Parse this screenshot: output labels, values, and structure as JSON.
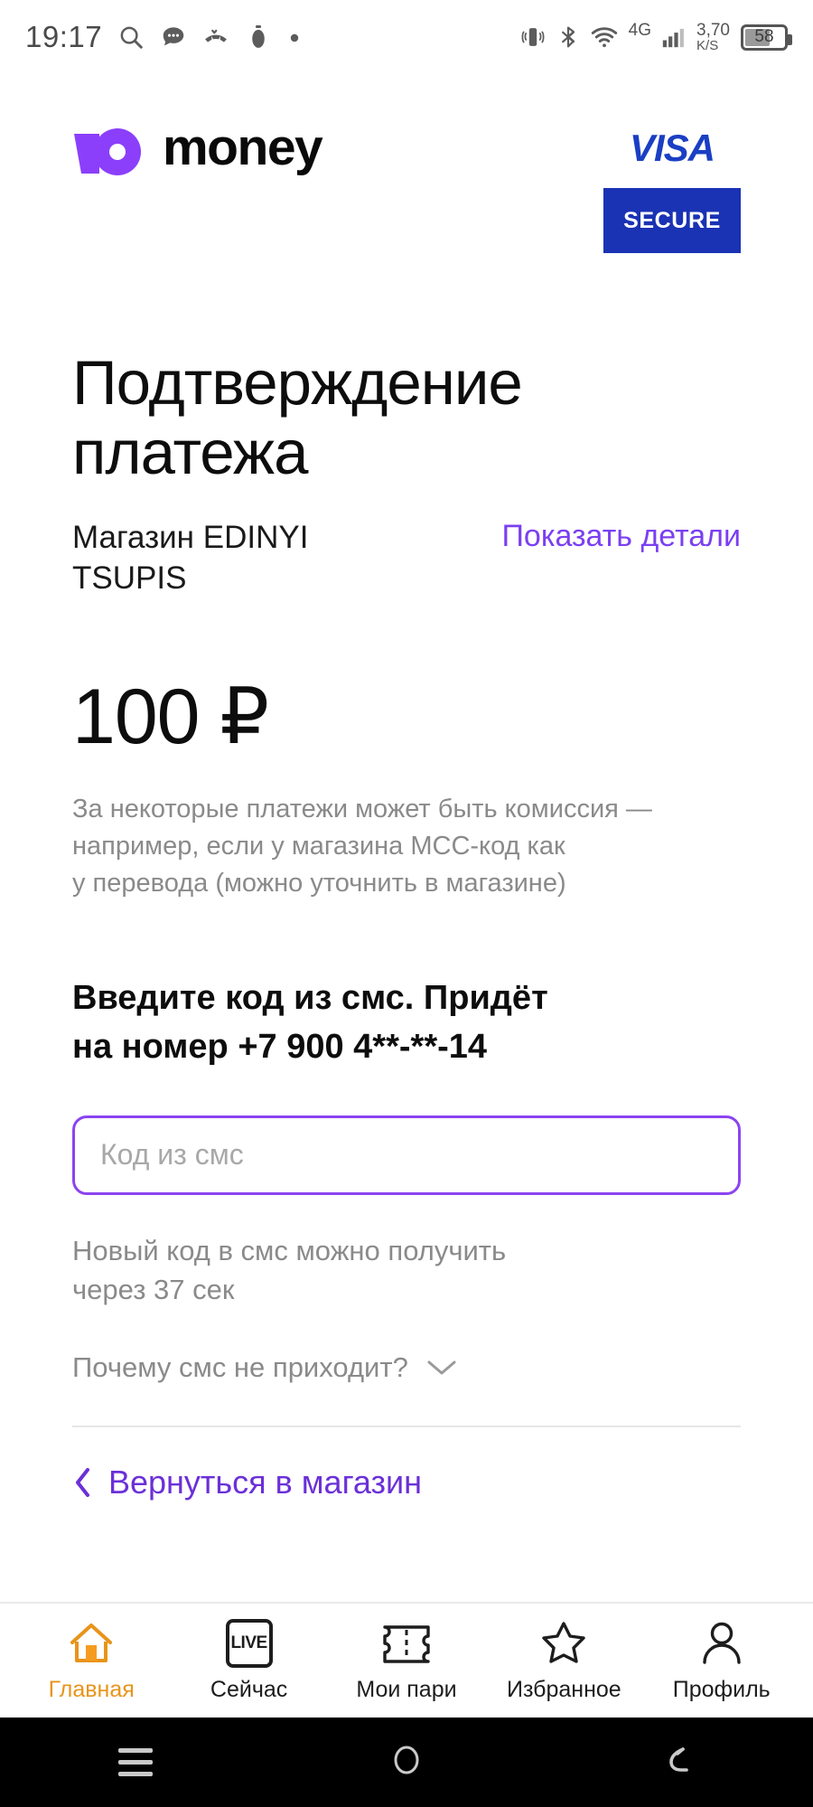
{
  "status_bar": {
    "time": "19:17",
    "left_icons": [
      "search-icon",
      "message-icon",
      "missed-call-icon",
      "timer-icon",
      "dot-icon"
    ],
    "right_icons": [
      "vibrate-icon",
      "bluetooth-icon",
      "wifi-icon",
      "signal-icon"
    ],
    "network_type": "4G",
    "data_rate_value": "3,70",
    "data_rate_unit": "K/S",
    "battery_level": "58"
  },
  "brand": {
    "logo_mark": "yoomoney-yu-icon",
    "logo_word": "money",
    "visa_word": "VISA",
    "visa_secure_label": "SECURE",
    "visa_blue": "#1a32b4"
  },
  "content": {
    "title": "Подтверждение платежа",
    "merchant_line1": "Магазин EDINYI",
    "merchant_line2": "TSUPIS",
    "show_details_link": "Показать детали",
    "amount": "100 ₽",
    "commission_note_line1": "За некоторые платежи может быть комиссия —",
    "commission_note_line2": "например, если у магазина MCC-код как",
    "commission_note_line3": "у перевода (можно уточнить в магазине)",
    "sms_heading_line1": "Введите код из смс. Придёт",
    "sms_heading_line2": "на номер +7 900 4**-**-14",
    "code_placeholder": "Код из смс",
    "code_value": "",
    "resend_line1": "Новый код в смс можно получить",
    "resend_line2": "через 37 сек",
    "resend_seconds": "37",
    "faq_question": "Почему смс не приходит?",
    "back_to_shop": "Вернуться в магазин",
    "accent_purple": "#7b3ff2"
  },
  "app_nav": {
    "items": [
      {
        "label": "Главная",
        "icon": "home-icon",
        "active": true
      },
      {
        "label": "Сейчас",
        "icon": "live-icon",
        "active": false
      },
      {
        "label": "Мои пари",
        "icon": "ticket-icon",
        "active": false
      },
      {
        "label": "Избранное",
        "icon": "star-icon",
        "active": false
      },
      {
        "label": "Профиль",
        "icon": "person-icon",
        "active": false
      }
    ],
    "active_color": "#e8941a",
    "live_badge_text": "LIVE"
  },
  "system_nav": {
    "recents": "recents-icon",
    "home": "home-circle-icon",
    "back": "back-arrow-icon"
  }
}
